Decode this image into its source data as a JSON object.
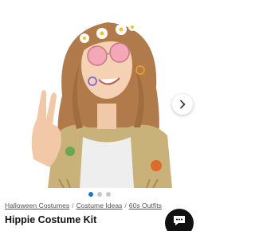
{
  "gallery": {
    "slide_count": 3,
    "active_slide": 1
  },
  "breadcrumb": {
    "items": [
      "Halloween Costumes",
      "Costume Ideas",
      "60s Outfits"
    ],
    "separator": "/"
  },
  "product": {
    "title": "Hippie Costume Kit"
  },
  "icons": {
    "next": "chevron-right-icon",
    "chat": "chat-bubble-icon"
  },
  "colors": {
    "accent": "#1a73c6",
    "chat_button": "#111111"
  }
}
